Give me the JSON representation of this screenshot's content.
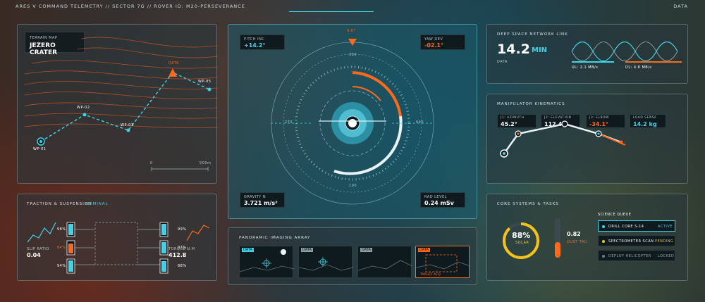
{
  "header": {
    "title": "ARES V COMMAND TELEMETRY // SECTOR 7G // ROVER ID: M20-PERSEVERANCE",
    "right_label": "DATA"
  },
  "terrain": {
    "title": "TERRAIN MAP",
    "name": "JEZERO CRATER",
    "waypoints": [
      "WP-01",
      "WP-02",
      "WP-03",
      "WP-05"
    ],
    "marker": "DATA",
    "scale_start": "0",
    "scale_end": "500m"
  },
  "traction": {
    "title": "TRACTION & SUSPENSION",
    "status": "NOMINAL",
    "slip_label": "SLIP RATIO",
    "slip_value": "0.04",
    "torque_label": "TORQUE N.M",
    "torque_value": "412.8",
    "wheels_left": [
      "98%",
      "84%",
      "94%"
    ],
    "wheels_right": [
      "99%",
      "97%",
      "88%"
    ]
  },
  "nav": {
    "pitch_label": "PITCH INC",
    "pitch_value": "+14.2°",
    "yaw_label": "YAW DEV",
    "yaw_value": "-02.1°",
    "heading": "0.0°",
    "gravity_label": "GRAVITY N",
    "gravity_value": "3.721 m/s²",
    "rad_label": "RAD LEVEL",
    "rad_value": "0.24 mSv",
    "dial_top": "300",
    "dial_bottom": "100",
    "dial_left": "270",
    "dial_right": "090"
  },
  "imaging": {
    "title": "PANORAMIC IMAGING ARRAY",
    "thumb_tags": [
      "DATA",
      "DATA",
      "DATA",
      "DATA"
    ],
    "target": "TARGET ACQ"
  },
  "dsn": {
    "title": "DEEP SPACE NETWORK LINK",
    "value": "14.2",
    "unit": "MIN",
    "sub": "DATA",
    "ul": "UL: 2.1 MB/s",
    "dl": "DL: 4.8 MB/s"
  },
  "kinematics": {
    "title": "MANIPULATOR KINEMATICS",
    "readouts": [
      {
        "label": "J1: AZIMUTH",
        "value": "45.2°"
      },
      {
        "label": "J2: ELEVATION",
        "value": "112.4°"
      },
      {
        "label": "J3: ELBOW",
        "value": "-34.1°"
      },
      {
        "label": "LOAD SENSE",
        "value": "14.2 kg"
      }
    ]
  },
  "core": {
    "title": "CORE SYSTEMS & TASKS",
    "solar_value": "88%",
    "solar_label": "SOLAR",
    "solar_fraction": 0.88,
    "dust_value": "0.82",
    "dust_label": "DUST TAU",
    "queue_title": "SCIENCE QUEUE",
    "tasks": [
      {
        "name": "DRILL CORE S-14",
        "status": "ACTIVE"
      },
      {
        "name": "SPECTROMETER SCAN",
        "status": "PENDING"
      },
      {
        "name": "DEPLOY HELICOPTER",
        "status": "LOCKED"
      }
    ]
  },
  "colors": {
    "cyan": "#3fd3e8",
    "orange": "#ff6a1a",
    "yellow": "#f6c21a"
  }
}
